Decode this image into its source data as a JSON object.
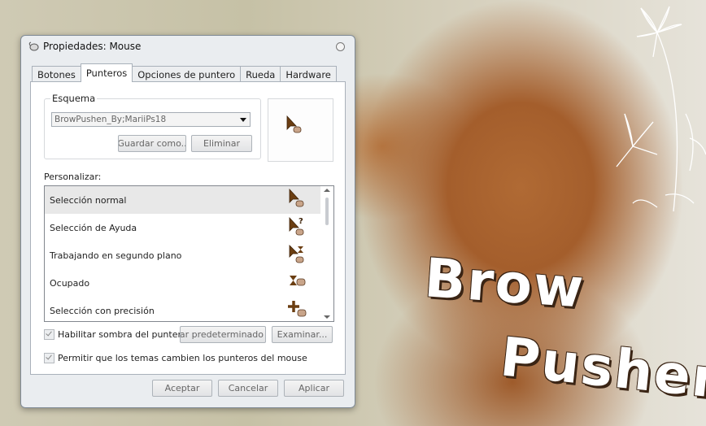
{
  "window": {
    "title": "Propiedades: Mouse"
  },
  "tabs": [
    {
      "label": "Botones"
    },
    {
      "label": "Punteros"
    },
    {
      "label": "Opciones de puntero"
    },
    {
      "label": "Rueda"
    },
    {
      "label": "Hardware"
    }
  ],
  "scheme": {
    "legend": "Esquema",
    "selected": "BrowPushen_By;MariiPs18",
    "save_as_label": "Guardar como..",
    "delete_label": "Eliminar"
  },
  "customize": {
    "label": "Personalizar:",
    "items": [
      {
        "label": "Selección normal",
        "icon": "arrow-cursor-icon"
      },
      {
        "label": "Selección de Ayuda",
        "icon": "help-cursor-icon"
      },
      {
        "label": "Trabajando en segundo plano",
        "icon": "working-cursor-icon"
      },
      {
        "label": "Ocupado",
        "icon": "hourglass-cursor-icon"
      },
      {
        "label": "Selección con precisión",
        "icon": "crosshair-cursor-icon"
      }
    ]
  },
  "options": {
    "shadow_label": "Habilitar sombra del puntero",
    "use_default_label": "Usar predeterminado",
    "browse_label": "Examinar...",
    "themes_label": "Permitir que los temas cambien los punteros del mouse"
  },
  "footer": {
    "accept": "Aceptar",
    "cancel": "Cancelar",
    "apply": "Aplicar"
  },
  "wallpaper": {
    "line1": "Brow",
    "line2": "Pushen"
  },
  "colors": {
    "cursor": "#6b3e12",
    "bear": "#a45e2c",
    "window_bg": "#ebeef2"
  }
}
